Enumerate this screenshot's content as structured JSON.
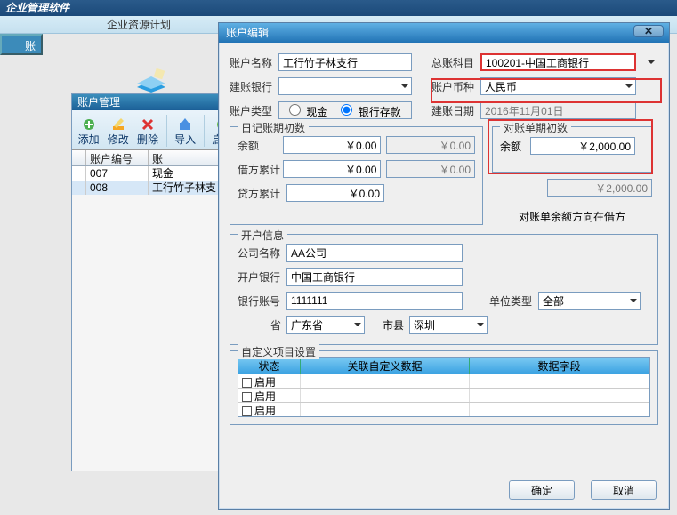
{
  "app": {
    "title": "企业管理软件",
    "ribbon": "企业资源计划"
  },
  "left_tab": "账",
  "child": {
    "title": "账户管理",
    "toolbar": [
      "添加",
      "修改",
      "删除",
      "导入",
      "启用"
    ],
    "grid": {
      "headers": {
        "num": "账户编号",
        "name": "账"
      },
      "rows": [
        {
          "num": "007",
          "name": "现金"
        },
        {
          "num": "008",
          "name": "工行竹子林支"
        }
      ]
    }
  },
  "dialog": {
    "title": "账户编辑",
    "labels": {
      "acct_name": "账户名称",
      "gl_subj": "总账科目",
      "bank": "建账银行",
      "currency": "账户币种",
      "acct_type": "账户类型",
      "build_date": "建账日期",
      "journal_begin": "日记账期初数",
      "balance": "余额",
      "debit": "借方累计",
      "credit": "贷方累计",
      "recon_begin": "对账单期初数",
      "recon_dir": "对账单余额方向在借方",
      "open_info": "开户信息",
      "company": "公司名称",
      "open_bank": "开户银行",
      "bank_acct": "银行账号",
      "province": "省",
      "city": "市县",
      "unit_type": "单位类型",
      "custom_section": "自定义项目设置"
    },
    "values": {
      "acct_name": "工行竹子林支行",
      "gl_subj": "100201-中国工商银行",
      "bank": "",
      "currency": "人民币",
      "type_cash": "现金",
      "type_bank": "银行存款",
      "build_date": "2016年11月01日",
      "balance": "￥0.00",
      "balance_ro": "￥0.00",
      "debit": "￥0.00",
      "debit_ro": "￥0.00",
      "credit": "￥0.00",
      "recon_balance": "￥2,000.00",
      "recon_ro": "￥2,000.00",
      "company": "AA公司",
      "open_bank": "中国工商银行",
      "bank_acct": "1111111",
      "province": "广东省",
      "city": "深圳",
      "unit_type": "全部"
    },
    "custom_grid": {
      "headers": {
        "status": "状态",
        "rel": "关联自定义数据",
        "field": "数据字段"
      },
      "row_label": "启用"
    },
    "buttons": {
      "ok": "确定",
      "cancel": "取消"
    }
  }
}
